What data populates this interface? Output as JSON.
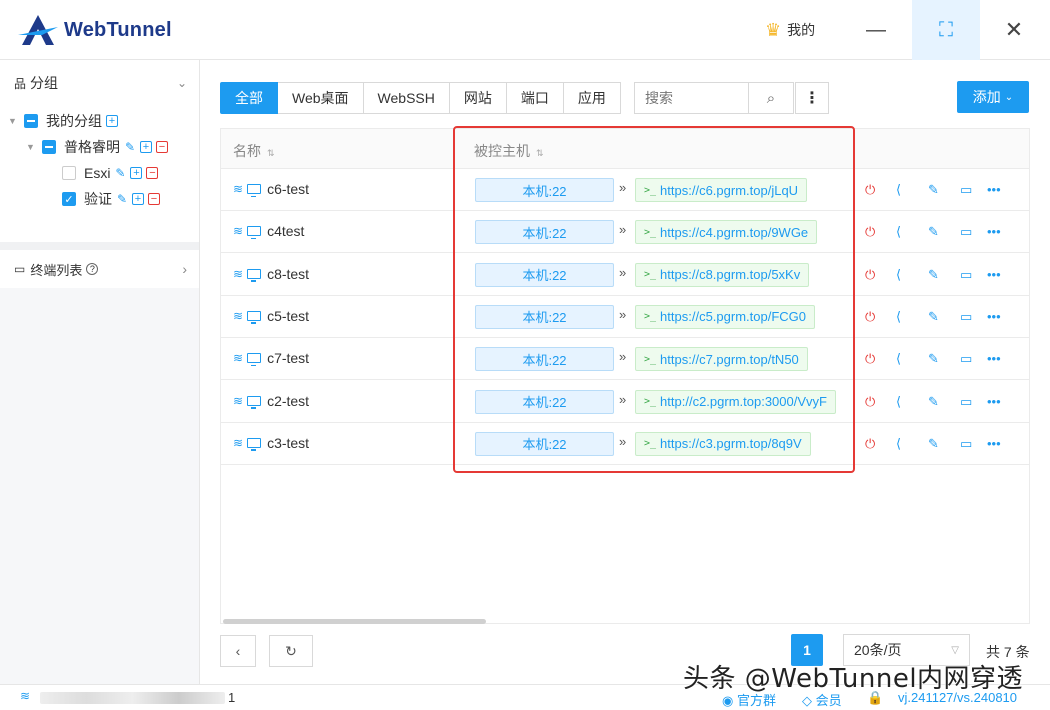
{
  "app": {
    "brand": "WebTunnel"
  },
  "header": {
    "mine_label": "我的",
    "minimize": "—",
    "maximize": "⛶",
    "close": "✕"
  },
  "sidebar": {
    "groups_title": "分组",
    "tree": {
      "root": "我的分组",
      "child": "普格睿明",
      "leaves": [
        {
          "label": "Esxi",
          "checked": false
        },
        {
          "label": "验证",
          "checked": true
        }
      ]
    },
    "terminal_list": "终端列表"
  },
  "toolbar": {
    "tabs": [
      "全部",
      "Web桌面",
      "WebSSH",
      "网站",
      "端口",
      "应用"
    ],
    "search_placeholder": "搜索",
    "add_label": "添加"
  },
  "table": {
    "columns": {
      "name": "名称",
      "host": "被控主机"
    },
    "rows": [
      {
        "name": "c6-test",
        "host": "本机:22",
        "url": "https://c6.pgrm.top/jLqU"
      },
      {
        "name": "c4test",
        "host": "本机:22",
        "url": "https://c4.pgrm.top/9WGe"
      },
      {
        "name": "c8-test",
        "host": "本机:22",
        "url": "https://c8.pgrm.top/5xKv"
      },
      {
        "name": "c5-test",
        "host": "本机:22",
        "url": "https://c5.pgrm.top/FCG0"
      },
      {
        "name": "c7-test",
        "host": "本机:22",
        "url": "https://c7.pgrm.top/tN50"
      },
      {
        "name": "c2-test",
        "host": "本机:22",
        "url": "http://c2.pgrm.top:3000/VvyF"
      },
      {
        "name": "c3-test",
        "host": "本机:22",
        "url": "https://c3.pgrm.top/8q9V"
      }
    ]
  },
  "pagination": {
    "current": "1",
    "page_size": "20条/页",
    "total": "共 7 条"
  },
  "statusbar": {
    "num": "1",
    "official_group": "官方群",
    "member": "会员",
    "version": "vj.241127/vs.240810"
  },
  "watermark": "头条 @WebTunnel内网穿透",
  "colors": {
    "accent": "#1d9bf0",
    "highlight": "#e53935",
    "brand": "#1e3a8a"
  }
}
